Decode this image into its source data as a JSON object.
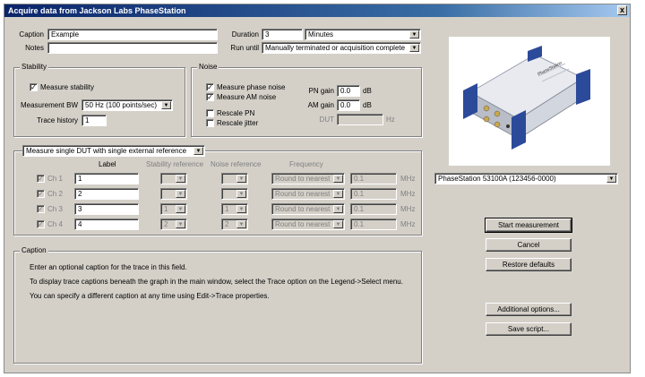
{
  "window": {
    "title": "Acquire data from Jackson Labs PhaseStation",
    "close": "x"
  },
  "top": {
    "caption_label": "Caption",
    "caption_value": "Example",
    "notes_label": "Notes",
    "notes_value": "",
    "duration_label": "Duration",
    "duration_value": "3",
    "duration_unit": "Minutes",
    "rununtil_label": "Run until",
    "rununtil_value": "Manually terminated or acquisition complete"
  },
  "stability": {
    "title": "Stability",
    "measure_label": "Measure stability",
    "measure_checked": "✓",
    "bw_label": "Measurement BW",
    "bw_value": "50 Hz (100 points/sec)",
    "history_label": "Trace history",
    "history_value": "1"
  },
  "noise": {
    "title": "Noise",
    "phase_label": "Measure phase noise",
    "phase_checked": "✓",
    "am_label": "Measure AM noise",
    "am_checked": "✓",
    "rescale_pn_label": "Rescale PN",
    "rescale_jitter_label": "Rescale jitter",
    "pn_gain_label": "PN gain",
    "pn_gain_value": "0.0",
    "pn_gain_unit": "dB",
    "am_gain_label": "AM gain",
    "am_gain_value": "0.0",
    "am_gain_unit": "dB",
    "dut_label": "DUT",
    "dut_value": "",
    "dut_unit": "Hz"
  },
  "channels": {
    "mode_value": "Measure single DUT with single external reference",
    "headers": {
      "label": "Label",
      "stab_ref": "Stability reference",
      "noise_ref": "Noise reference",
      "freq": "Frequency"
    },
    "rows": [
      {
        "name": "Ch 1",
        "label": "1",
        "stab": "",
        "noise": "",
        "round": "Round to nearest",
        "freq": "0.1",
        "unit": "MHz"
      },
      {
        "name": "Ch 2",
        "label": "2",
        "stab": "",
        "noise": "",
        "round": "Round to nearest",
        "freq": "0.1",
        "unit": "MHz"
      },
      {
        "name": "Ch 3",
        "label": "3",
        "stab": "1",
        "noise": "1",
        "round": "Round to nearest",
        "freq": "0.1",
        "unit": "MHz"
      },
      {
        "name": "Ch 4",
        "label": "4",
        "stab": "2",
        "noise": "2",
        "round": "Round to nearest",
        "freq": "0.1",
        "unit": "MHz"
      }
    ],
    "checked": "✓"
  },
  "help": {
    "title": "Caption",
    "line1": "Enter an optional caption for the trace in this field.",
    "line2": "To display trace captions beneath the graph in the main window, select the Trace option on the Legend->Select menu.",
    "line3": "You can specify a different caption at any time using Edit->Trace properties."
  },
  "device": {
    "selected": "PhaseStation 53100A (123456-0000)",
    "brand_text": "PhaseStation"
  },
  "buttons": {
    "start": "Start measurement",
    "cancel": "Cancel",
    "restore": "Restore defaults",
    "additional": "Additional options...",
    "save_script": "Save script..."
  },
  "icons": {
    "arrow": "▼"
  }
}
